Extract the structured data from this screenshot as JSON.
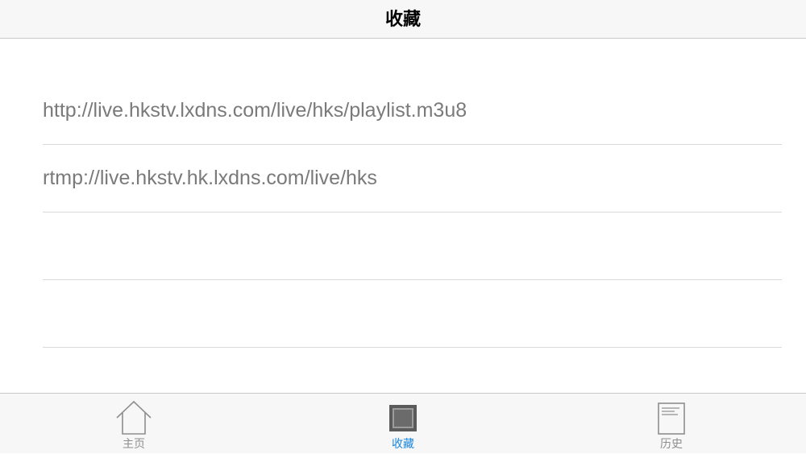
{
  "header": {
    "title": "收藏"
  },
  "favorites": [
    {
      "url": "http://live.hkstv.lxdns.com/live/hks/playlist.m3u8"
    },
    {
      "url": "rtmp://live.hkstv.hk.lxdns.com/live/hks"
    },
    {
      "url": ""
    },
    {
      "url": ""
    }
  ],
  "tabbar": {
    "tabs": [
      {
        "label": "主页",
        "icon": "home-icon",
        "active": false
      },
      {
        "label": "收藏",
        "icon": "favorites-icon",
        "active": true
      },
      {
        "label": "历史",
        "icon": "history-icon",
        "active": false
      }
    ],
    "active_color": "#1a86e0",
    "inactive_color": "#8e8e8e"
  }
}
